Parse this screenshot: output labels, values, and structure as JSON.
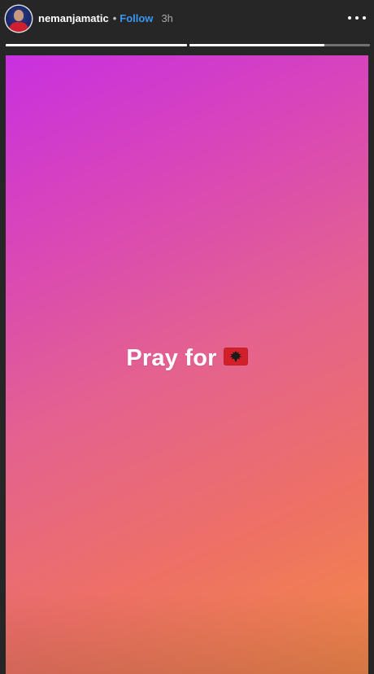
{
  "header": {
    "username": "nemanjamatic",
    "separator": "•",
    "follow_label": "Follow",
    "time_ago": "3h"
  },
  "progress": {
    "segments": [
      {
        "fill_fraction": 1.0
      },
      {
        "fill_fraction": 0.75
      }
    ]
  },
  "story": {
    "caption_text": "Pray for",
    "flag_icon": "albania-flag-icon",
    "gradient_colors": [
      "#c930e0",
      "#d946b8",
      "#e4628e",
      "#ee7065",
      "#f38a45"
    ]
  },
  "icons": {
    "more": "more-options-icon",
    "avatar": "profile-avatar"
  }
}
